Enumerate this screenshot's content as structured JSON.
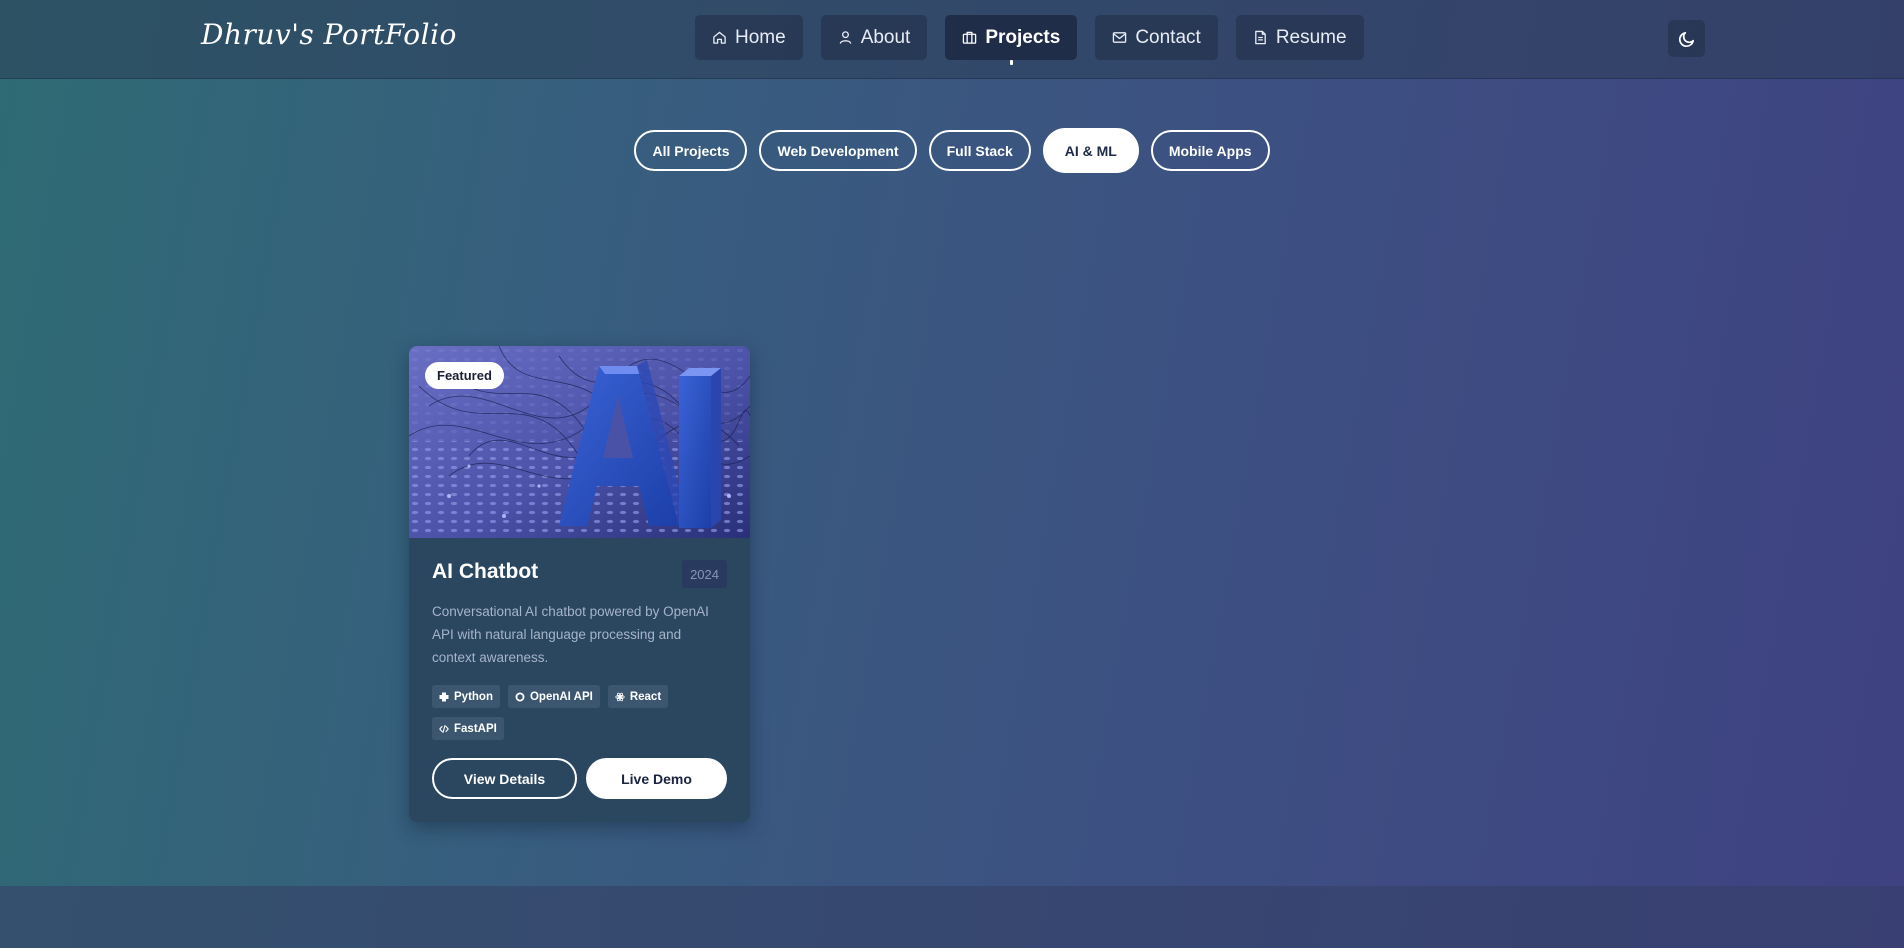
{
  "brand": {
    "name": "Dhruv's PortFolio"
  },
  "nav": {
    "items": [
      {
        "label": "Home",
        "icon": "home-icon",
        "active": false
      },
      {
        "label": "About",
        "icon": "user-icon",
        "active": false
      },
      {
        "label": "Projects",
        "icon": "briefcase-icon",
        "active": true
      },
      {
        "label": "Contact",
        "icon": "mail-icon",
        "active": false
      },
      {
        "label": "Resume",
        "icon": "document-icon",
        "active": false
      }
    ],
    "theme_toggle_icon": "moon-icon"
  },
  "filters": {
    "items": [
      {
        "label": "All Projects",
        "active": false
      },
      {
        "label": "Web Development",
        "active": false
      },
      {
        "label": "Full Stack",
        "active": false
      },
      {
        "label": "AI & ML",
        "active": true
      },
      {
        "label": "Mobile Apps",
        "active": false
      }
    ]
  },
  "projects": [
    {
      "badge": "Featured",
      "title": "AI Chatbot",
      "year": "2024",
      "description": "Conversational AI chatbot powered by OpenAI API with natural language processing and context awareness.",
      "tags": [
        {
          "label": "Python",
          "icon": "python-icon"
        },
        {
          "label": "OpenAI API",
          "icon": "openai-icon"
        },
        {
          "label": "React",
          "icon": "react-icon"
        },
        {
          "label": "FastAPI",
          "icon": "code-icon"
        }
      ],
      "actions": {
        "details_label": "View Details",
        "demo_label": "Live Demo"
      },
      "image_text": "AI"
    }
  ],
  "colors": {
    "accent": "#ffffff",
    "card_bg": "#2b4760",
    "tag_bg": "#3c5670",
    "year_badge_bg": "#283a5e"
  }
}
